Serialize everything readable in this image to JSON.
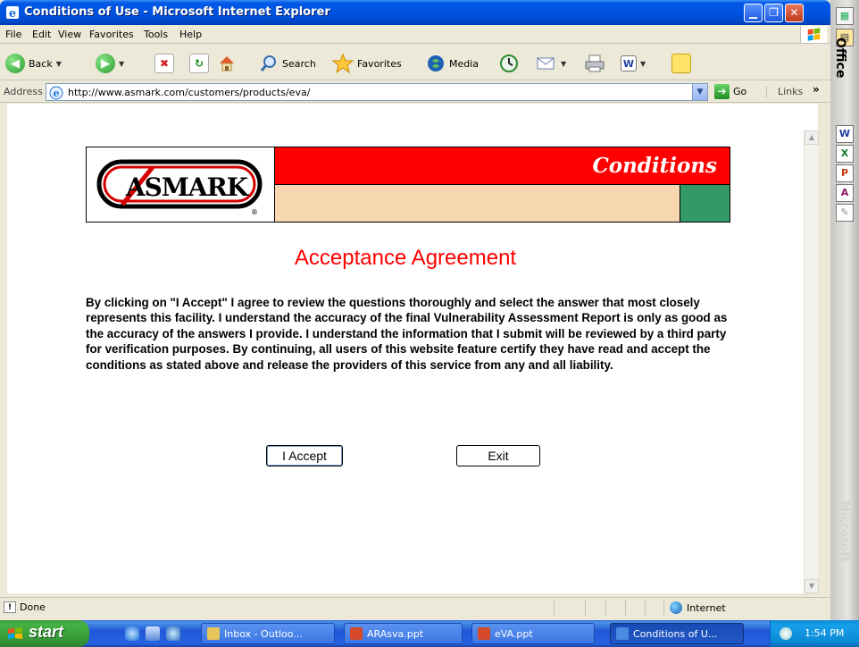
{
  "window": {
    "title": "Conditions of Use - Microsoft Internet Explorer",
    "min_glyph": "▁",
    "max_glyph": "❐",
    "close_glyph": "✕"
  },
  "menu": {
    "items": [
      "File",
      "Edit",
      "View",
      "Favorites",
      "Tools",
      "Help"
    ]
  },
  "toolbar": {
    "back_label": "Back",
    "search_label": "Search",
    "favorites_label": "Favorites",
    "media_label": "Media"
  },
  "address": {
    "label": "Address",
    "url": "http://www.asmark.com/customers/products/eva/",
    "go_label": "Go",
    "links_label": "Links",
    "chevron": "»"
  },
  "page": {
    "banner_title": "Conditions",
    "logo_text": "ASMARK",
    "logo_mark": "®",
    "heading": "Acceptance Agreement",
    "agreement_text": "By clicking on \"I Accept\" I agree to review the questions thoroughly and select the answer that most closely represents this facility. I understand the accuracy of the final Vulnerability Assessment Report is only as good as the accuracy of the answers I provide. I understand the information that I submit will be reviewed by a third party for verification purposes. By continuing, all users of this website feature certify they have read and accept the conditions as stated above and release the providers of this service from any and all liability.",
    "accept_label": "I Accept",
    "exit_label": "Exit"
  },
  "status": {
    "text": "Done",
    "zone": "Internet"
  },
  "officebar": {
    "label": "Office",
    "watermark": "Microsoft"
  },
  "taskbar": {
    "start_label": "start",
    "tasks": [
      {
        "label": "Inbox - Outloo...",
        "color": "#e8c65a"
      },
      {
        "label": "ARAsva.ppt",
        "color": "#d44a2a"
      },
      {
        "label": "eVA.ppt",
        "color": "#d44a2a"
      },
      {
        "label": "Conditions of U...",
        "color": "#4a8ae0"
      }
    ],
    "clock": "1:54 PM"
  },
  "colors": {
    "banner_red": "#ff0000",
    "banner_tan": "#f7d7b0",
    "banner_green": "#339966",
    "heading_red": "#ff0000"
  }
}
